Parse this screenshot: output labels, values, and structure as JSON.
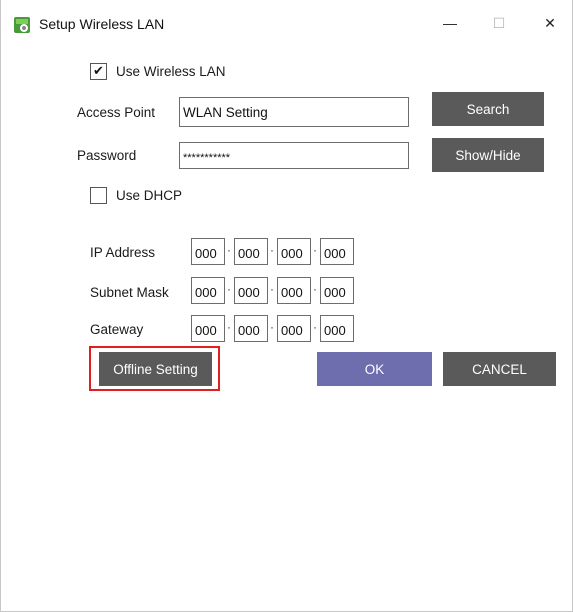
{
  "window": {
    "title": "Setup Wireless LAN",
    "controls": {
      "minimize": "—",
      "maximize": "☐",
      "close": "✕"
    }
  },
  "use_wireless": {
    "label": "Use Wireless LAN",
    "checked": true,
    "check_glyph": "✔"
  },
  "access_point": {
    "label": "Access Point",
    "value": "WLAN Setting"
  },
  "password": {
    "label": "Password",
    "value": "***********"
  },
  "buttons": {
    "search": "Search",
    "show_hide": "Show/Hide",
    "offline": "Offline Setting",
    "ok": "OK",
    "cancel": "CANCEL"
  },
  "use_dhcp": {
    "label": "Use DHCP",
    "checked": false
  },
  "ip_address": {
    "label": "IP Address",
    "octets": [
      "000",
      "000",
      "000",
      "000"
    ]
  },
  "subnet_mask": {
    "label": "Subnet Mask",
    "octets": [
      "000",
      "000",
      "000",
      "000"
    ]
  },
  "gateway": {
    "label": "Gateway",
    "octets": [
      "000",
      "000",
      "000",
      "000"
    ]
  },
  "separator": "·",
  "colors": {
    "button_gray": "#5a5a5a",
    "button_ok": "#6e6eaf",
    "highlight": "#e02020"
  }
}
